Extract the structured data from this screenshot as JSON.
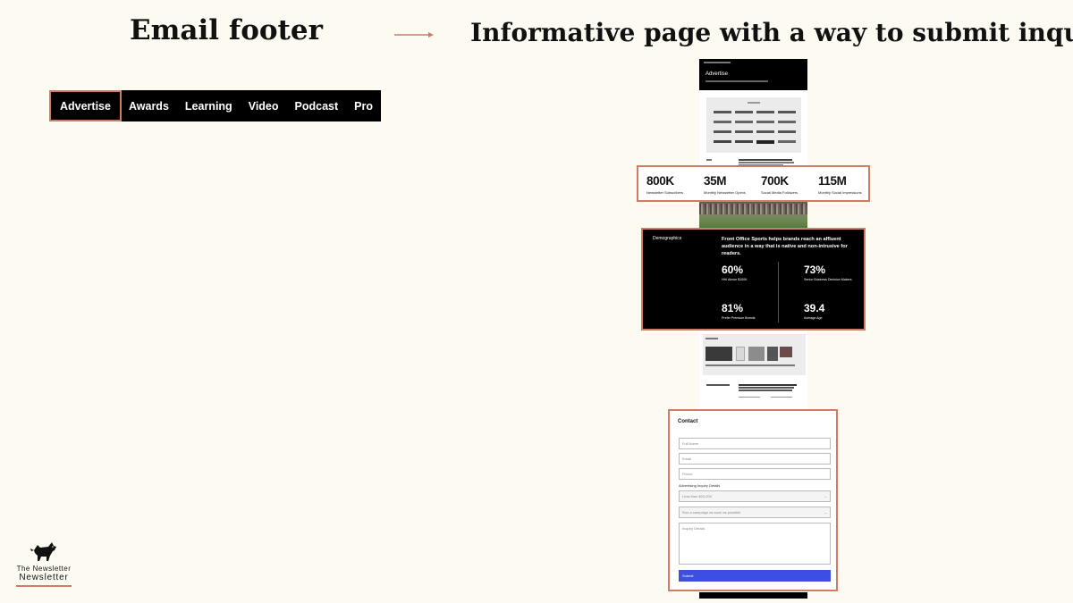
{
  "titles": {
    "left": "Email footer",
    "right": "Informative page with a way to submit inquiry"
  },
  "footer_nav": [
    "Advertise",
    "Awards",
    "Learning",
    "Video",
    "Podcast",
    "Pro"
  ],
  "page": {
    "hero_title": "Advertise",
    "stats": [
      {
        "value": "800K",
        "label": "Newsletter Subscribers"
      },
      {
        "value": "35M",
        "label": "Monthly Newsletter Opens"
      },
      {
        "value": "700K",
        "label": "Social Media Followers"
      },
      {
        "value": "115M",
        "label": "Monthly Social Impressions"
      }
    ],
    "demographics": {
      "heading": "Demographics",
      "blurb": "Front Office Sports helps brands reach an affluent audience in a way that is native and non-intrusive for readers.",
      "items": [
        {
          "value": "60%",
          "label": "HHI Above $100K"
        },
        {
          "value": "73%",
          "label": "Senior Business Decision Makers"
        },
        {
          "value": "81%",
          "label": "Prefer Premium Brands"
        },
        {
          "value": "39.4",
          "label": "Average Age"
        }
      ]
    },
    "contact": {
      "heading": "Contact",
      "full_name": "Full Name",
      "email": "Email",
      "phone": "Phone",
      "details_label": "Advertising Inquiry Details",
      "budget": "Less than $20,000",
      "timing": "Run a campaign as soon as possible",
      "inquiry": "Inquiry Details",
      "submit": "Submit"
    }
  },
  "brand": {
    "line1": "The Newsletter",
    "line2": "Newsletter"
  },
  "colors": {
    "background": "#fdfbf1",
    "accent": "#d07b66",
    "submit": "#3d4fe0"
  }
}
